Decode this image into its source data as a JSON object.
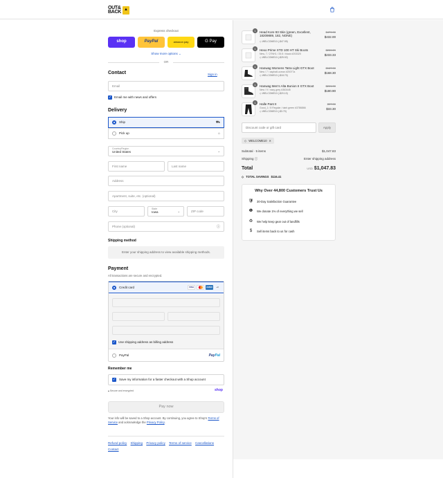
{
  "brand": {
    "logo_text": "OUT& BACK"
  },
  "express": {
    "title": "Express checkout",
    "shop_label": "shop",
    "paypal_label": "PayPal",
    "amazon_label": "amazon pay",
    "gpay_label": "G Pay",
    "show_more": "Show more options",
    "or": "OR"
  },
  "contact": {
    "heading": "Contact",
    "sign_in": "Sign in",
    "email_placeholder": "Email",
    "newsletter_label": "Email me with news and offers"
  },
  "delivery": {
    "heading": "Delivery",
    "option_ship": "Ship",
    "option_pickup": "Pick up",
    "country_label": "Country/Region",
    "country_value": "United States",
    "first_name_placeholder": "First name",
    "last_name_placeholder": "Last name",
    "address_placeholder": "Address",
    "apartment_placeholder": "Apartment, suite, etc. (optional)",
    "city_placeholder": "City",
    "state_label": "State",
    "state_value": "Iowa",
    "zip_placeholder": "ZIP code",
    "phone_placeholder": "Phone (optional)"
  },
  "shipping_method": {
    "heading": "Shipping method",
    "note": "Enter your shipping address to view available shipping methods."
  },
  "payment": {
    "heading": "Payment",
    "subtitle": "All transactions are secure and encrypted.",
    "credit_card_label": "Credit card",
    "cards": [
      "VISA",
      "",
      "AMEX",
      "+3"
    ],
    "billing_label": "Use shipping address as billing address",
    "paypal_option": "PayPal",
    "paypal_logo_a": "Pay",
    "paypal_logo_b": "Pal"
  },
  "remember": {
    "heading": "Remember me",
    "save_label": "Save my information for a faster checkout with a Shop account",
    "secure_note": "Secure and encrypted",
    "shop_logo": "shop"
  },
  "pay_now": "Pay now",
  "legal": {
    "text": "Your info will be saved to a Shop account. By continuing, you agree to Shop's",
    "terms": "Terms of Service",
    "and": "and acknowledge the",
    "privacy": "Privacy Policy",
    "end": "."
  },
  "footer_links": [
    "Refund policy",
    "Shipping",
    "Privacy policy",
    "Terms of service",
    "Cancellations",
    "Contact"
  ],
  "cart": {
    "items": [
      {
        "qty": "1",
        "name": "Head Kore 93 Skis (green, Excellent, 18209889, 182, NONE)",
        "variant": "",
        "discount": "WELCOME10 (-$47.99)",
        "orig": "$479.00",
        "price": "$432.00"
      },
      {
        "qty": "1",
        "name": "Hexo Prime XTD 100 HT Ski Boots",
        "variant": "New, 7 / 27NH1 / 25.5 / black #203320",
        "discount": "WELCOME10 (-$25.92)",
        "orig": "$259.29",
        "price": "$233.33"
      },
      {
        "qty": "1",
        "name": "Hanwag Womens Tatra Light GTX Boot",
        "variant": "New / 7 / asphalt-ocean #20077a",
        "discount": "WELCOME10 (-$18.70)",
        "orig": "$187.00",
        "price": "$168.30"
      },
      {
        "qty": "1",
        "name": "Hanwag Men's Alta Bunion II GTX Boot",
        "variant": "New / 9 / navy-grey #363445",
        "discount": "WELCOME10 (-$20.10)",
        "orig": "$201.00",
        "price": "$180.90"
      },
      {
        "qty": "1",
        "name": "Halle Pant II",
        "variant": "Good_1 / 8 Regular / dark green #3786866",
        "discount": "WELCOME10 (-$3.70)",
        "orig": "$37.00",
        "price": "$33.30"
      }
    ],
    "discount_placeholder": "Discount code or gift card",
    "apply_label": "Apply",
    "applied_code": "WELCOME10",
    "subtotal_label": "Subtotal · 5 items",
    "subtotal_value": "$1,047.83",
    "shipping_label": "Shipping",
    "shipping_value": "Enter shipping address",
    "total_label": "Total",
    "currency": "USD",
    "total_value": "$1,047.83",
    "savings_label": "TOTAL SAVINGS",
    "savings_value": "$116.41"
  },
  "trust": {
    "title": "Why Over 44,800 Customers Trust Us",
    "rows": [
      "30-Day Satisfaction Guarantee",
      "We donate 1% of everything we sell",
      "We help keep gear out of landfills",
      "Sell items back to us for cash"
    ]
  }
}
